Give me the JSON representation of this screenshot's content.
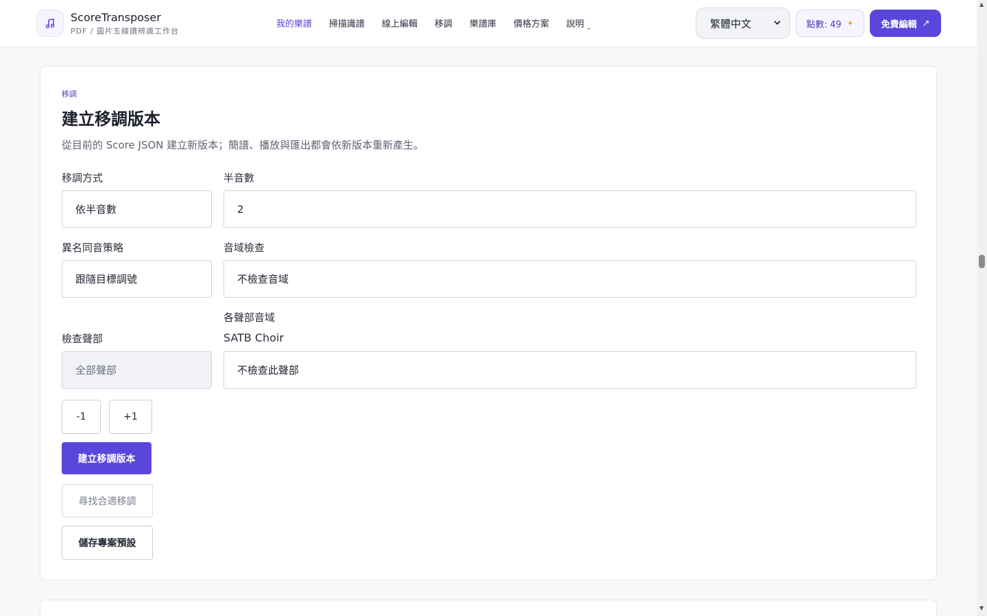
{
  "header": {
    "brand_name": "ScoreTransposer",
    "brand_sub": "PDF / 圖片五線譜辨識工作台",
    "nav": [
      {
        "label": "我的樂譜",
        "active": true
      },
      {
        "label": "掃描識譜"
      },
      {
        "label": "線上編輯"
      },
      {
        "label": "移調"
      },
      {
        "label": "樂譜庫"
      },
      {
        "label": "價格方案"
      },
      {
        "label": "說明",
        "dropdown": true
      }
    ],
    "language": "繁體中文",
    "credits": "點數: 49",
    "cta": "免費編輯",
    "accent_color": "#5a46db"
  },
  "transpose": {
    "eyebrow": "移調",
    "title": "建立移調版本",
    "description": "從目前的 Score JSON 建立新版本；簡譜、播放與匯出都會依新版本重新產生。",
    "method_label": "移調方式",
    "method_value": "依半音數",
    "semitones_label": "半音數",
    "semitones_value": "2",
    "enharmonic_label": "異名同音策略",
    "enharmonic_value": "跟隨目標調號",
    "range_check_label": "音域檢查",
    "range_check_value": "不檢查音域",
    "part_ranges_label": "各聲部音域",
    "check_parts_label": "檢查聲部",
    "check_parts_value": "全部聲部",
    "part_name": "SATB Choir",
    "part_range_value": "不檢查此聲部",
    "minus_button": "-1",
    "plus_button": "+1",
    "create_button": "建立移調版本",
    "find_button": "尋找合適移調",
    "save_button": "儲存專案預設"
  }
}
